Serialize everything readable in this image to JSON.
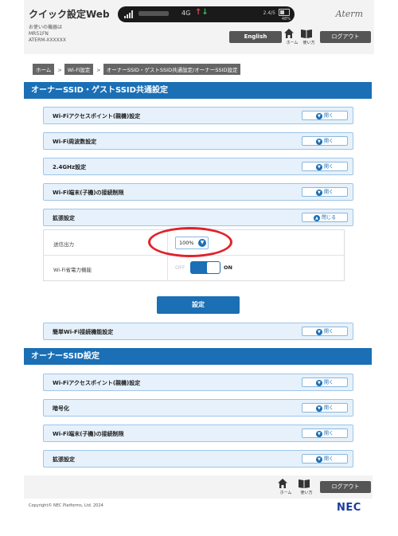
{
  "header": {
    "app_title": "クイック設定Web",
    "device_label_line1": "お使いの機器は",
    "device_label_line2": "MR51FN",
    "device_label_line3": "ATERM-XXXXXX",
    "brand": "Aterm",
    "english_button": "English",
    "home_label": "ホーム",
    "help_label": "使い方",
    "logout_button": "ログアウト"
  },
  "status_bar": {
    "network_type": "4G",
    "info_text": "2.4/5",
    "battery_percent": "48%",
    "battery_level": 0.48,
    "colors": {
      "upload": "#e14b4b",
      "download": "#3fbf5a"
    }
  },
  "breadcrumb": {
    "items": [
      "ホーム",
      "Wi-Fi設定",
      "オーナーSSID・ゲストSSID共通設定/オーナーSSID設定"
    ],
    "separator": ">"
  },
  "section_common": {
    "title": "オーナーSSID・ゲストSSID共通設定",
    "accordions": [
      {
        "title": "Wi-Fiアクセスポイント(親機)設定",
        "toggle": "開く"
      },
      {
        "title": "Wi-Fi周波数設定",
        "toggle": "開く"
      },
      {
        "title": "2.4GHz設定",
        "toggle": "開く"
      },
      {
        "title": "Wi-Fi端末(子機)の接続制限",
        "toggle": "開く"
      },
      {
        "title": "拡張設定",
        "toggle": "閉じる"
      }
    ],
    "extended": {
      "tx_power_label": "送信出力",
      "tx_power_value": "100%",
      "power_save_label": "Wi-Fi省電力機能",
      "power_save_off": "OFF",
      "power_save_on": "ON",
      "power_save_state": "ON"
    },
    "apply_button": "設定",
    "easy_connect": {
      "title": "簡単Wi-Fi接続機能設定",
      "toggle": "開く"
    }
  },
  "section_owner": {
    "title": "オーナーSSID設定",
    "accordions": [
      {
        "title": "Wi-Fiアクセスポイント(親機)設定",
        "toggle": "開く"
      },
      {
        "title": "暗号化",
        "toggle": "開く"
      },
      {
        "title": "Wi-Fi端末(子機)の接続制限",
        "toggle": "開く"
      },
      {
        "title": "拡張設定",
        "toggle": "開く"
      }
    ]
  },
  "footer": {
    "home_label": "ホーム",
    "help_label": "使い方",
    "logout_button": "ログアウト",
    "copyright": "Copyright© NEC Platforms, Ltd. 2024",
    "logo": "NEC"
  },
  "colors": {
    "accent": "#1a6fb5",
    "accordion_bg": "#e6f1fb",
    "highlight": "#e0222a",
    "dark_button": "#555555"
  }
}
